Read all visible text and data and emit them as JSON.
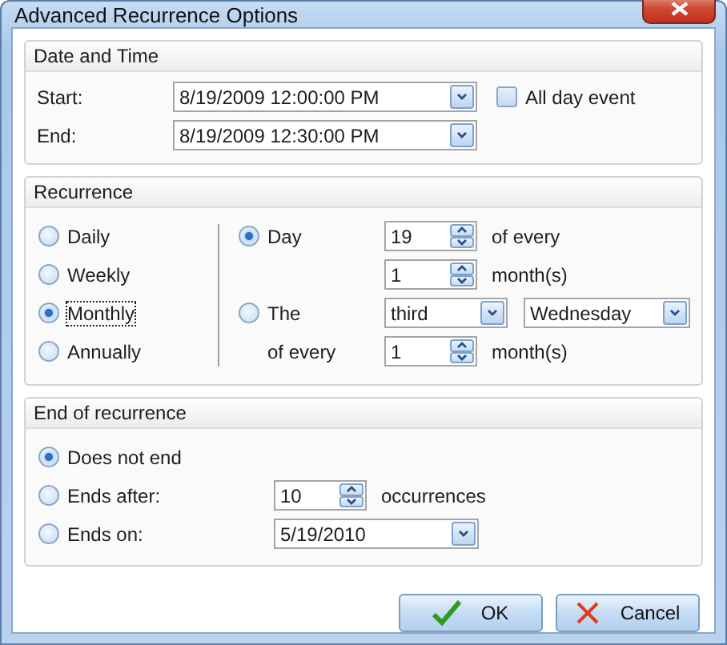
{
  "window": {
    "title": "Advanced Recurrence Options"
  },
  "date_time": {
    "title": "Date and Time",
    "start": {
      "label": "Start:",
      "value": "8/19/2009 12:00:00 PM"
    },
    "end": {
      "label": "End:",
      "value": "8/19/2009 12:30:00 PM"
    },
    "all_day": {
      "label": "All day event",
      "checked": false
    }
  },
  "recurrence": {
    "title": "Recurrence",
    "patterns": [
      {
        "label": "Daily",
        "selected": false,
        "focused": false
      },
      {
        "label": "Weekly",
        "selected": false,
        "focused": false
      },
      {
        "label": "Monthly",
        "selected": true,
        "focused": true
      },
      {
        "label": "Annually",
        "selected": false,
        "focused": false
      }
    ],
    "day_option": {
      "label": "Day",
      "selected": true
    },
    "day_value": "19",
    "day_suffix": "of every",
    "day_months": "1",
    "day_months_unit": "month(s)",
    "the_option": {
      "label": "The",
      "selected": false
    },
    "ordinal": "third",
    "weekday": "Wednesday",
    "the_prefix": "of every",
    "the_months": "1",
    "the_months_unit": "month(s)"
  },
  "end_of_recurrence": {
    "title": "End of recurrence",
    "options": [
      {
        "kind": "plain",
        "label": "Does not end",
        "selected": true
      },
      {
        "kind": "count",
        "label": "Ends after:",
        "selected": false,
        "value": "10",
        "unit": "occurrences"
      },
      {
        "kind": "date",
        "label": "Ends on:",
        "selected": false,
        "value": "5/19/2010"
      }
    ]
  },
  "buttons": [
    {
      "kind": "ok",
      "label": "OK"
    },
    {
      "kind": "cancel",
      "label": "Cancel"
    }
  ]
}
